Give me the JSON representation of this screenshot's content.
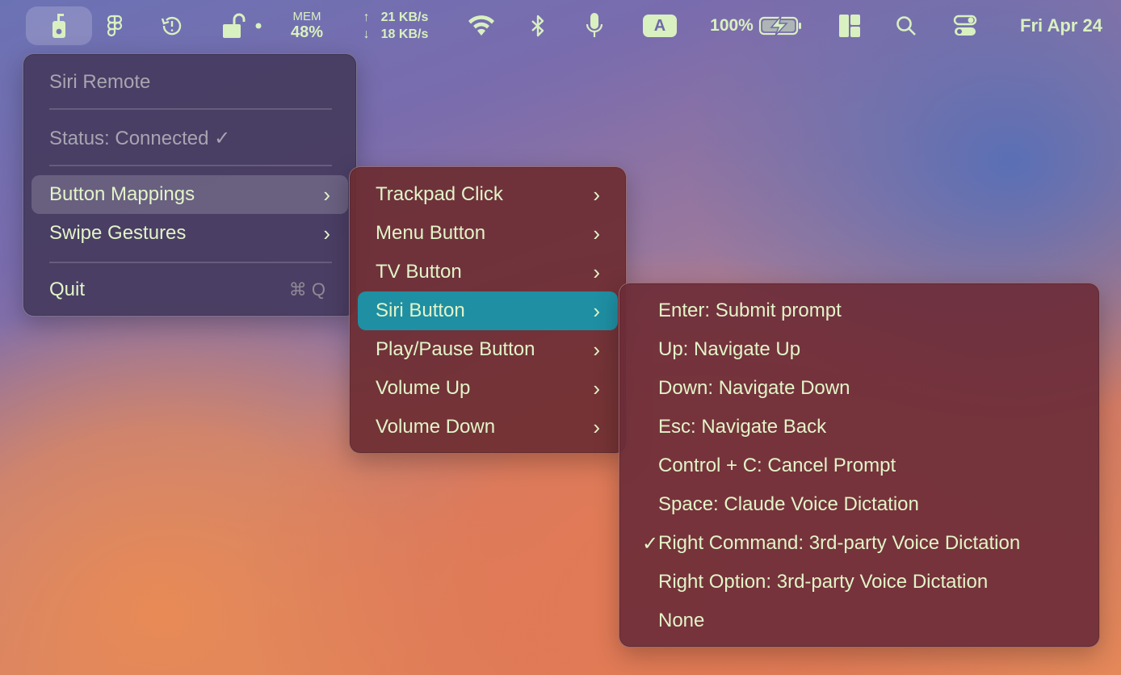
{
  "menubar": {
    "mem_label": "MEM",
    "mem_value": "48%",
    "net_up_arrow": "↑",
    "net_down_arrow": "↓",
    "net_up": "21 KB/s",
    "net_down": "18 KB/s",
    "input_source": "A",
    "battery": "100%",
    "date": "Fri Apr 24",
    "icons": [
      "remote-icon",
      "figma-icon",
      "time-machine-icon",
      "lock-icon",
      "wifi-icon",
      "bluetooth-icon",
      "microphone-icon",
      "battery-charging-icon",
      "window-layout-icon",
      "search-icon",
      "control-center-icon"
    ]
  },
  "menu1": {
    "title": "Siri Remote",
    "status": "Status: Connected ✓",
    "items": [
      {
        "label": "Button Mappings"
      },
      {
        "label": "Swipe Gestures"
      }
    ],
    "quit": "Quit",
    "quit_shortcut": "⌘ Q"
  },
  "menu2": {
    "items": [
      {
        "label": "Trackpad Click"
      },
      {
        "label": "Menu Button"
      },
      {
        "label": "TV Button"
      },
      {
        "label": "Siri Button"
      },
      {
        "label": "Play/Pause Button"
      },
      {
        "label": "Volume Up"
      },
      {
        "label": "Volume Down"
      }
    ]
  },
  "menu3": {
    "checkmark": "✓",
    "items": [
      {
        "label": "Enter: Submit prompt"
      },
      {
        "label": "Up: Navigate Up"
      },
      {
        "label": "Down: Navigate Down"
      },
      {
        "label": "Esc: Navigate Back"
      },
      {
        "label": "Control + C: Cancel Prompt"
      },
      {
        "label": "Space: Claude Voice Dictation"
      },
      {
        "label": "Right Command: 3rd-party Voice Dictation"
      },
      {
        "label": "Right Option: 3rd-party Voice Dictation"
      },
      {
        "label": "None"
      }
    ]
  },
  "colors": {
    "menu_text": "#e2f4c8",
    "highlight": "#1f8fa3"
  }
}
